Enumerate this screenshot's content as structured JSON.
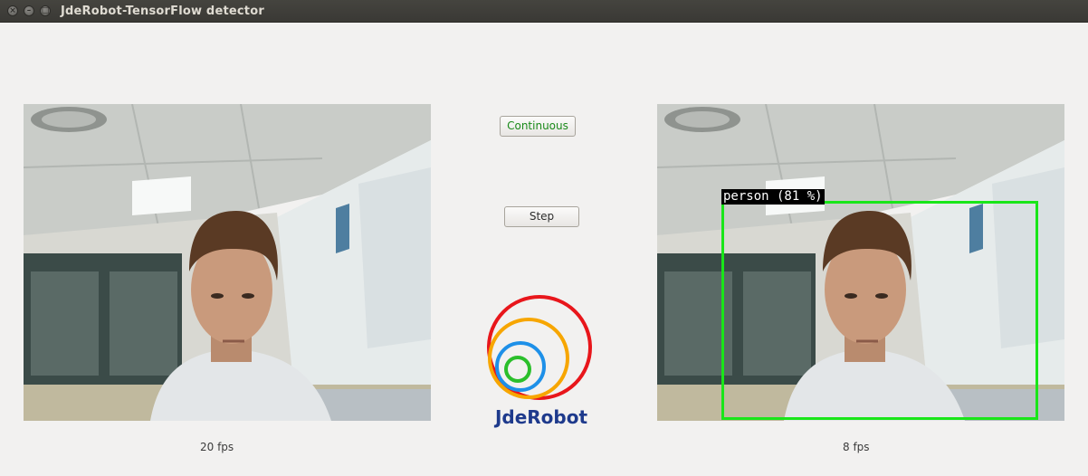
{
  "window": {
    "title": "JdeRobot-TensorFlow detector"
  },
  "controls": {
    "continuous_label": "Continuous",
    "step_label": "Step"
  },
  "left_panel": {
    "fps_text": "20 fps"
  },
  "right_panel": {
    "fps_text": "8 fps",
    "detection": {
      "label": "person (81 %)",
      "box_color": "#19e619"
    }
  },
  "logo": {
    "text": "JdeRobot",
    "ring_colors": [
      "#e8161b",
      "#f7a600",
      "#1e90e8",
      "#2bbf2b"
    ],
    "text_color": "#1e3a8c"
  },
  "colors": {
    "continuous_text": "#1a8a1a",
    "background": "#f2f1f0",
    "titlebar": "#3d3c38"
  }
}
